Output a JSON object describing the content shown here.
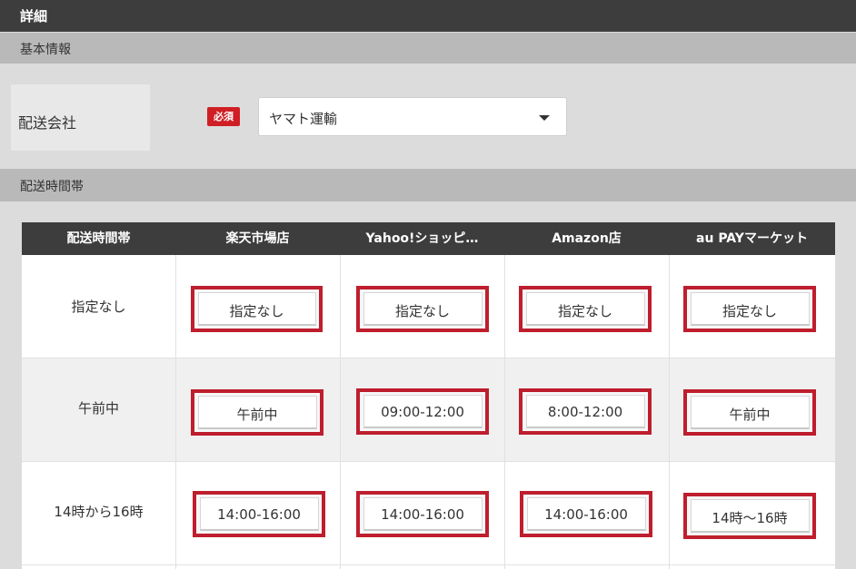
{
  "header": {
    "title": "詳細"
  },
  "basic_info": {
    "section_title": "基本情報",
    "carrier_label": "配送会社",
    "required_badge": "必須",
    "carrier_value": "ヤマト運輸"
  },
  "time_slots": {
    "section_title": "配送時間帯",
    "columns": [
      "配送時間帯",
      "楽天市場店",
      "Yahoo!ショッピ…",
      "Amazon店",
      "au PAYマーケット"
    ],
    "rows": [
      {
        "label": "指定なし",
        "values": [
          "指定なし",
          "指定なし",
          "指定なし",
          "指定なし"
        ]
      },
      {
        "label": "午前中",
        "values": [
          "午前中",
          "09:00-12:00",
          "8:00-12:00",
          "午前中"
        ]
      },
      {
        "label": "14時から16時",
        "values": [
          "14:00-16:00",
          "14:00-16:00",
          "14:00-16:00",
          "14時〜16時"
        ]
      }
    ]
  },
  "colors": {
    "header_bg": "#3d3d3d",
    "highlight_border": "#be1e2d",
    "required_badge": "#cf1f25"
  }
}
